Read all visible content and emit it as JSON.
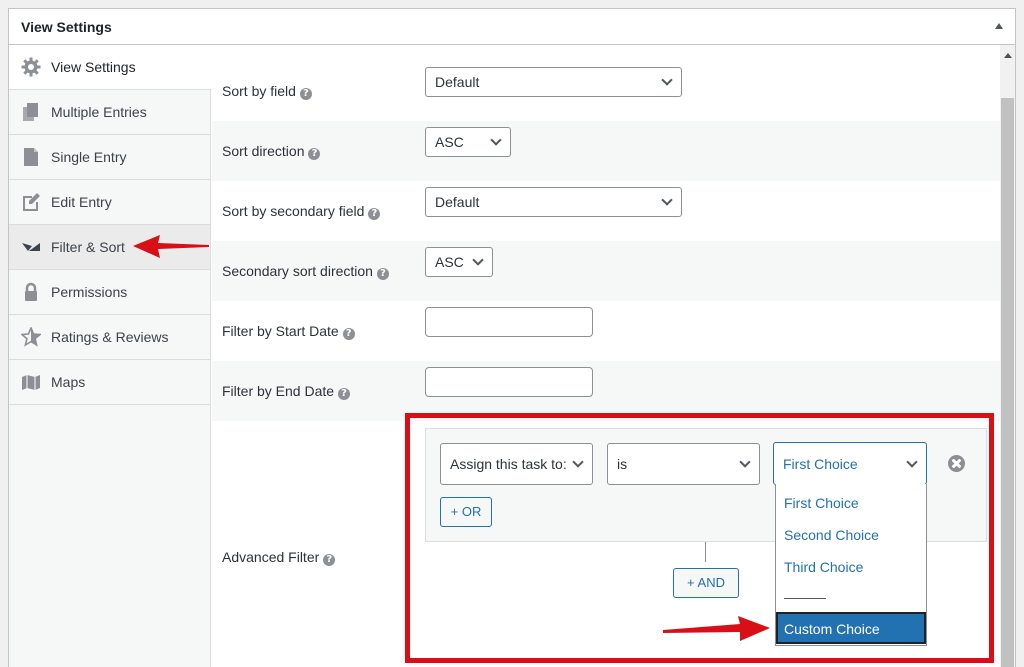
{
  "panel": {
    "title": "View Settings"
  },
  "sidebar": {
    "items": [
      {
        "label": "View Settings",
        "icon": "gear-icon"
      },
      {
        "label": "Multiple Entries",
        "icon": "copy-icon"
      },
      {
        "label": "Single Entry",
        "icon": "document-icon"
      },
      {
        "label": "Edit Entry",
        "icon": "edit-icon"
      },
      {
        "label": "Filter & Sort",
        "icon": "filter-icon"
      },
      {
        "label": "Permissions",
        "icon": "lock-icon"
      },
      {
        "label": "Ratings & Reviews",
        "icon": "star-icon"
      },
      {
        "label": "Maps",
        "icon": "map-icon"
      }
    ]
  },
  "settings": {
    "sort_by_field": {
      "label": "Sort by field",
      "value": "Default"
    },
    "sort_direction": {
      "label": "Sort direction",
      "value": "ASC"
    },
    "sort_secondary_field": {
      "label": "Sort by secondary field",
      "value": "Default"
    },
    "secondary_direction": {
      "label": "Secondary sort direction",
      "value": "ASC"
    },
    "start_date": {
      "label": "Filter by Start Date",
      "value": ""
    },
    "end_date": {
      "label": "Filter by End Date",
      "value": ""
    },
    "advanced_filter": {
      "label": "Advanced Filter"
    }
  },
  "help_glyph": "?",
  "filter": {
    "field": "Assign this task to:",
    "operator": "is",
    "value": "First Choice",
    "or_button": "+ OR",
    "and_button": "+ AND",
    "options": [
      "First Choice",
      "Second Choice",
      "Third Choice",
      "Custom Choice"
    ]
  },
  "colors": {
    "accent": "#2271b1",
    "highlight": "#d80f17"
  }
}
